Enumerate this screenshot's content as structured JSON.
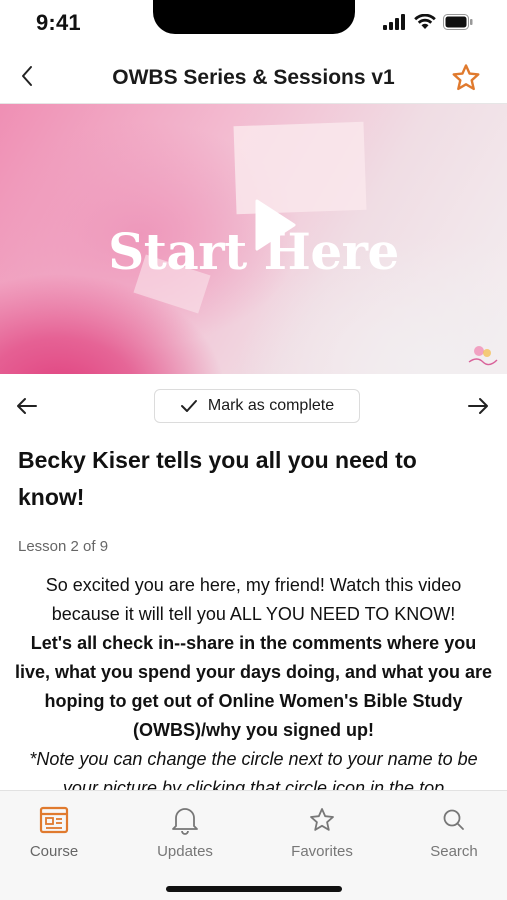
{
  "status_bar": {
    "time": "9:41"
  },
  "header": {
    "title": "OWBS Series & Sessions v1"
  },
  "video": {
    "overlay_title": "Start Here"
  },
  "lesson_nav": {
    "mark_complete_label": "Mark as complete"
  },
  "lesson": {
    "title": "Becky Kiser tells you all you need to know!",
    "count": "Lesson 2 of 9",
    "paragraph_1": "So excited you are here, my friend! Watch this video because it will tell you ALL YOU NEED TO KNOW!",
    "paragraph_2": "Let's all check in--share in the comments where you live, what you spend your days doing, and what you are hoping to get out of Online Women's Bible Study (OWBS)/why you signed up!",
    "paragraph_3": "*Note you can change the circle next to your name to be your picture by clicking that circle icon in the top"
  },
  "tabs": [
    {
      "label": "Course",
      "icon": "course-icon"
    },
    {
      "label": "Updates",
      "icon": "bell-icon"
    },
    {
      "label": "Favorites",
      "icon": "star-icon"
    },
    {
      "label": "Search",
      "icon": "search-icon"
    }
  ],
  "colors": {
    "accent": "#e07a2e",
    "tab_inactive": "#777777",
    "video_pink": "#e0407e"
  }
}
